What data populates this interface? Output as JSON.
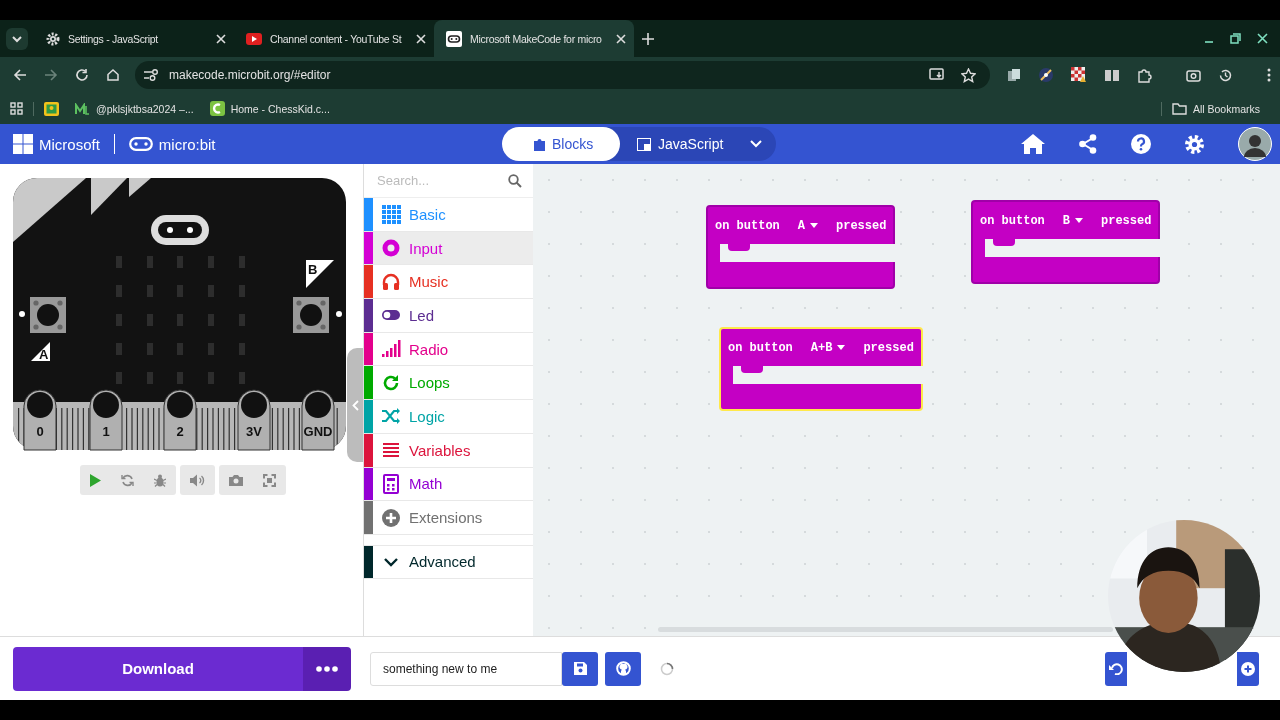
{
  "browser": {
    "tabs": [
      {
        "title": "Settings - JavaScript",
        "selected": false
      },
      {
        "title": "Channel content - YouTube St",
        "selected": false
      },
      {
        "title": "Microsoft MakeCode for micro",
        "selected": true
      }
    ],
    "url": "makecode.microbit.org/#editor",
    "bookmarks": [
      {
        "title": "@pklsjktbsa2024 –..."
      },
      {
        "title": "Home - ChessKid.c..."
      }
    ],
    "all_bookmarks": "All Bookmarks"
  },
  "header": {
    "brand": "Microsoft",
    "product": "micro:bit",
    "editor_tabs": [
      {
        "label": "Blocks",
        "selected": true
      },
      {
        "label": "JavaScript",
        "selected": false
      }
    ]
  },
  "simulator": {
    "button_labels": [
      "A",
      "B"
    ],
    "pins": [
      "0",
      "1",
      "2",
      "3V",
      "GND"
    ]
  },
  "toolbox": {
    "search": {
      "placeholder": "Search..."
    },
    "categories": [
      {
        "label": "Basic",
        "color": "#1e90ff",
        "highlighted": false
      },
      {
        "label": "Input",
        "color": "#d400d4",
        "highlighted": true
      },
      {
        "label": "Music",
        "color": "#e63022",
        "highlighted": false
      },
      {
        "label": "Led",
        "color": "#5c2d91",
        "highlighted": false
      },
      {
        "label": "Radio",
        "color": "#e3008c",
        "highlighted": false
      },
      {
        "label": "Loops",
        "color": "#00aa00",
        "highlighted": false
      },
      {
        "label": "Logic",
        "color": "#00a4a6",
        "highlighted": false
      },
      {
        "label": "Variables",
        "color": "#dc143c",
        "highlighted": false
      },
      {
        "label": "Math",
        "color": "#9400d3",
        "highlighted": false
      },
      {
        "label": "Extensions",
        "color": "#717171",
        "highlighted": false
      }
    ],
    "advanced": {
      "label": "Advanced",
      "color": "#00272b"
    }
  },
  "blocks": [
    {
      "prefix": "on button",
      "option": "A",
      "suffix": "pressed",
      "selected": false
    },
    {
      "prefix": "on button",
      "option": "B",
      "suffix": "pressed",
      "selected": false
    },
    {
      "prefix": "on button",
      "option": "A+B",
      "suffix": "pressed",
      "selected": true
    }
  ],
  "footer": {
    "download": "Download",
    "project_name": "something new to me"
  }
}
